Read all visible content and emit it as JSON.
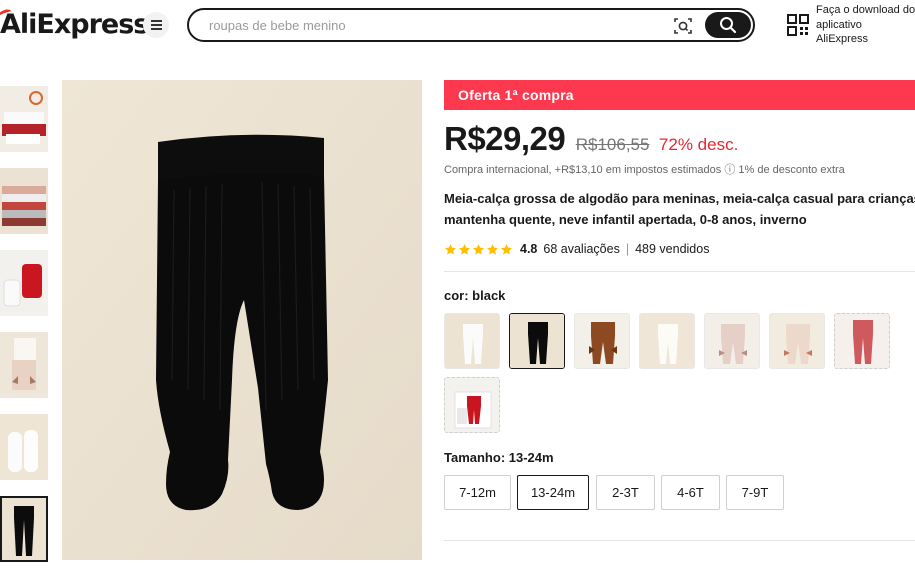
{
  "header": {
    "logo_text": "AliExpress",
    "search_placeholder": "roupas de bebe menino",
    "app_download_text": "Faça o download do aplicativo AliExpress"
  },
  "gallery": {
    "thumbnails": [
      "thumb-white-red-tights",
      "thumb-striped-pack",
      "thumb-red-tights",
      "thumb-bow-tights",
      "thumb-white-tights",
      "thumb-black-tights"
    ],
    "active_index": 5,
    "main_image": "black-baby-tights"
  },
  "promo": {
    "banner": "Oferta 1ª compra"
  },
  "pricing": {
    "price": "R$29,29",
    "old_price": "R$106,55",
    "discount": "72% desc.",
    "tax_info": "Compra internacional, +R$13,10 em impostos estimados ⓘ 1% de desconto extra"
  },
  "product": {
    "title_line1": "Meia-calça grossa de algodão para meninas, meia-calça casual para crianças,",
    "title_line2": "mantenha quente, neve infantil apertada, 0-8 anos, inverno",
    "rating": "4.8",
    "reviews": "68 avaliações",
    "sold": "489 vendidos",
    "stars": 5
  },
  "color": {
    "label": "cor: black",
    "selected": "black",
    "swatches": [
      "white",
      "black",
      "brown-bow",
      "cream",
      "pink-bow",
      "beige-bow",
      "red",
      "red-white"
    ]
  },
  "size": {
    "label": "Tamanho: 13-24m",
    "options": [
      "7-12m",
      "13-24m",
      "2-3T",
      "4-6T",
      "7-9T"
    ],
    "selected": "13-24m"
  },
  "colors": {
    "accent": "#fd384f",
    "discount": "#e6282f",
    "star": "#fdbf00",
    "text": "#191919"
  }
}
